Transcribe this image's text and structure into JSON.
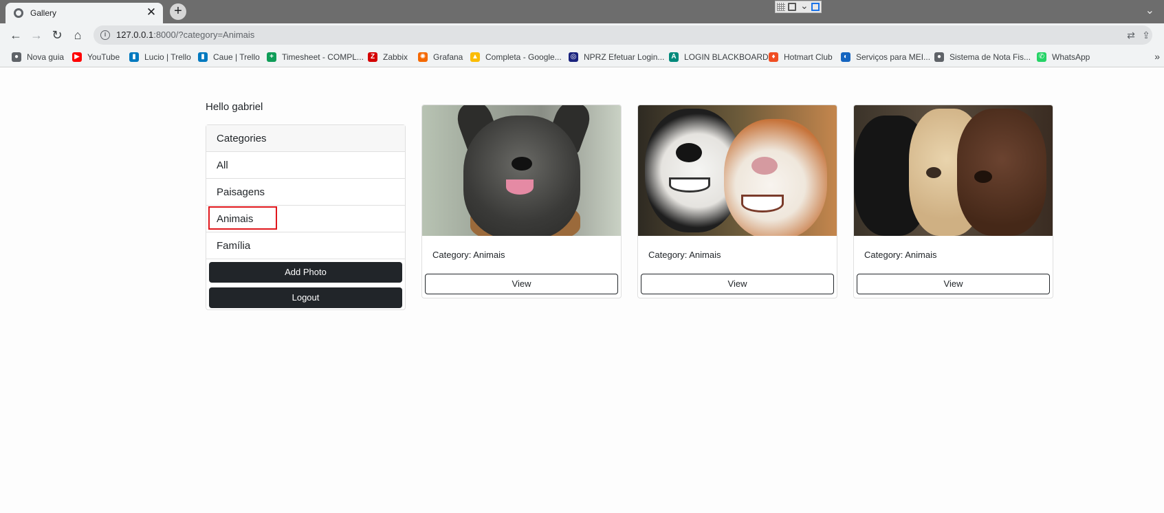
{
  "browser": {
    "tab_title": "Gallery",
    "tab_close": "✕",
    "new_tab": "+",
    "url_host": "127.0.0.1",
    "url_rest": ":8000/?category=Animais",
    "bookmarks": [
      {
        "label": "Nova guia",
        "icon": "globe-icon",
        "color": "#5f6368",
        "glyph": "●"
      },
      {
        "label": "YouTube",
        "icon": "youtube-icon",
        "color": "#ff0000",
        "glyph": "▶"
      },
      {
        "label": "Lucio | Trello",
        "icon": "trello-icon",
        "color": "#0079bf",
        "glyph": "▮"
      },
      {
        "label": "Caue | Trello",
        "icon": "trello-icon",
        "color": "#0079bf",
        "glyph": "▮"
      },
      {
        "label": "Timesheet - COMPL...",
        "icon": "sheets-icon",
        "color": "#0f9d58",
        "glyph": "+"
      },
      {
        "label": "Zabbix",
        "icon": "zabbix-icon",
        "color": "#d40000",
        "glyph": "Z"
      },
      {
        "label": "Grafana",
        "icon": "grafana-icon",
        "color": "#f46800",
        "glyph": "✺"
      },
      {
        "label": "Completa - Google...",
        "icon": "drive-icon",
        "color": "#fbbc04",
        "glyph": "▲"
      },
      {
        "label": "NPRZ Efetuar Login...",
        "icon": "nprz-icon",
        "color": "#1a237e",
        "glyph": "◎"
      },
      {
        "label": "LOGIN BLACKBOARD",
        "icon": "blackboard-icon",
        "color": "#00897b",
        "glyph": "A"
      },
      {
        "label": "Hotmart Club",
        "icon": "hotmart-icon",
        "color": "#f04e23",
        "glyph": "♦"
      },
      {
        "label": "Serviços para MEI...",
        "icon": "gov-icon",
        "color": "#1565c0",
        "glyph": "◐"
      },
      {
        "label": "Sistema de Nota Fis...",
        "icon": "globe-icon",
        "color": "#5f6368",
        "glyph": "●"
      },
      {
        "label": "WhatsApp",
        "icon": "whatsapp-icon",
        "color": "#25d366",
        "glyph": "✆"
      }
    ],
    "bookmarks_more": "»"
  },
  "page": {
    "greeting": "Hello gabriel",
    "categories_title": "Categories",
    "categories": [
      "All",
      "Paisagens",
      "Animais",
      "Família"
    ],
    "selected_category": "Animais",
    "add_photo_label": "Add Photo",
    "logout_label": "Logout",
    "photos": [
      {
        "caption": "Category: Animais",
        "view_label": "View"
      },
      {
        "caption": "Category: Animais",
        "view_label": "View"
      },
      {
        "caption": "Category: Animais",
        "view_label": "View"
      }
    ]
  },
  "colors": {
    "button_dark": "#212529",
    "highlight_border": "#e0161b"
  }
}
